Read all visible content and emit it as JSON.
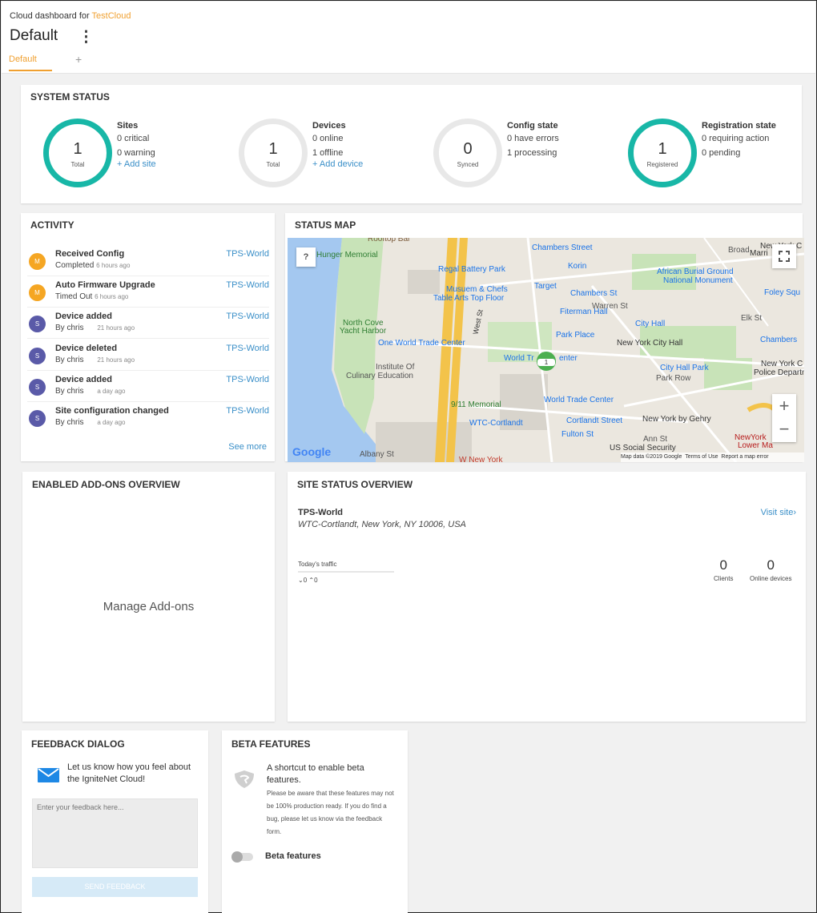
{
  "header": {
    "breadcrumb_prefix": "Cloud dashboard for",
    "cloud_name": "TestCloud",
    "dashboard_title": "Default",
    "menu_icon": "kebab-menu-icon",
    "tabs": [
      {
        "label": "Default"
      }
    ],
    "add_tab_icon": "+"
  },
  "system_status": {
    "title": "SYSTEM STATUS",
    "stats": [
      {
        "value": "1",
        "caption": "Total",
        "heading": "Sites",
        "lines": [
          "0 critical",
          "0 warning"
        ],
        "link": "+ Add site",
        "active": true
      },
      {
        "value": "1",
        "caption": "Total",
        "heading": "Devices",
        "lines": [
          "0 online",
          "1 offline"
        ],
        "link": "+ Add device",
        "active": false
      },
      {
        "value": "0",
        "caption": "Synced",
        "heading": "Config state",
        "lines": [
          "0 have errors",
          "1 processing"
        ],
        "link": "",
        "active": false
      },
      {
        "value": "1",
        "caption": "Registered",
        "heading": "Registration state",
        "lines": [
          "0 requiring action",
          "0 pending"
        ],
        "link": "",
        "active": true
      }
    ]
  },
  "activity": {
    "title": "ACTIVITY",
    "items": [
      {
        "avatar": "M",
        "avatar_color": "#f5a623",
        "title": "Received Config",
        "status": "Completed",
        "ago": "6 hours ago",
        "site": "TPS-World"
      },
      {
        "avatar": "M",
        "avatar_color": "#f5a623",
        "title": "Auto Firmware Upgrade",
        "status": "Timed Out",
        "ago": "6 hours ago",
        "site": "TPS-World"
      },
      {
        "avatar": "S",
        "avatar_color": "#5a5aa8",
        "title": "Device added",
        "status": "By chris",
        "ago": "21 hours ago",
        "site": "TPS-World"
      },
      {
        "avatar": "S",
        "avatar_color": "#5a5aa8",
        "title": "Device deleted",
        "status": "By chris",
        "ago": "21 hours ago",
        "site": "TPS-World"
      },
      {
        "avatar": "S",
        "avatar_color": "#5a5aa8",
        "title": "Device added",
        "status": "By chris",
        "ago": "a day ago",
        "site": "TPS-World"
      },
      {
        "avatar": "S",
        "avatar_color": "#5a5aa8",
        "title": "Site configuration changed",
        "status": "By chris",
        "ago": "a day ago",
        "site": "TPS-World"
      }
    ],
    "see_more": "See more"
  },
  "status_map": {
    "title": "STATUS MAP",
    "help_icon": "?",
    "labels": [
      "Rooftop Bar",
      "Hunger Memorial",
      "Chambers Street",
      "Regal Battery Park",
      "Korin",
      "African Burial Ground",
      "National Monument",
      "Musuem & Chefs",
      "Table Arts Top Floor",
      "Target",
      "Chambers St",
      "Foley Squ",
      "Fiterman Hall",
      "North Cove",
      "Yacht Harbor",
      "City Hall",
      "Park Place",
      "New York City Hall",
      "Chambers",
      "One World Trade Center",
      "World Tr",
      "enter",
      "Institute Of",
      "Culinary Education",
      "City Hall Park",
      "New York C",
      "Police Departme",
      "Park Row",
      "9/11 Memorial",
      "World Trade Center",
      "WTC-Cortlandt",
      "Cortlandt Street",
      "New York by Gehry",
      "Fulton St",
      "NewYork",
      "Lower Ma",
      "US Social Security",
      "West St",
      "Warren St",
      "Elk St",
      "Ann St",
      "Albany St",
      "W New York",
      "New York C",
      "Marri",
      "Broad"
    ],
    "cluster_count": "1",
    "google": "Google",
    "attribution": "Map data ©2019 Google",
    "terms": "Terms of Use",
    "report": "Report a map error",
    "zoom_in": "+",
    "zoom_out": "−",
    "fullscreen_icon": "fullscreen-icon"
  },
  "addons": {
    "title": "ENABLED ADD-ONS OVERVIEW",
    "manage": "Manage Add-ons"
  },
  "site_status": {
    "title": "SITE STATUS OVERVIEW",
    "site_name": "TPS-World",
    "address": "WTC-Cortlandt, New York, NY 10006, USA",
    "visit": "Visit site",
    "traffic_label": "Today's traffic",
    "traffic_down": "0",
    "traffic_up": "0",
    "clients_value": "0",
    "clients_label": "Clients",
    "online_value": "0",
    "online_label": "Online devices"
  },
  "feedback": {
    "title": "FEEDBACK DIALOG",
    "prompt": "Let us know how you feel about the IgniteNet Cloud!",
    "placeholder": "Enter your feedback here...",
    "button": "SEND FEEDBACK"
  },
  "beta": {
    "title": "BETA FEATURES",
    "heading": "A shortcut to enable beta features.",
    "description": "Please be aware that these features may not be 100% production ready. If you do find a bug, please let us know via the feedback form.",
    "toggle_label": "Beta features",
    "enabled": false
  },
  "colors": {
    "accent": "#f0a030",
    "link": "#3a8fc8",
    "ring_active": "#18b7a7",
    "ring_inactive": "#e8e8e8"
  }
}
